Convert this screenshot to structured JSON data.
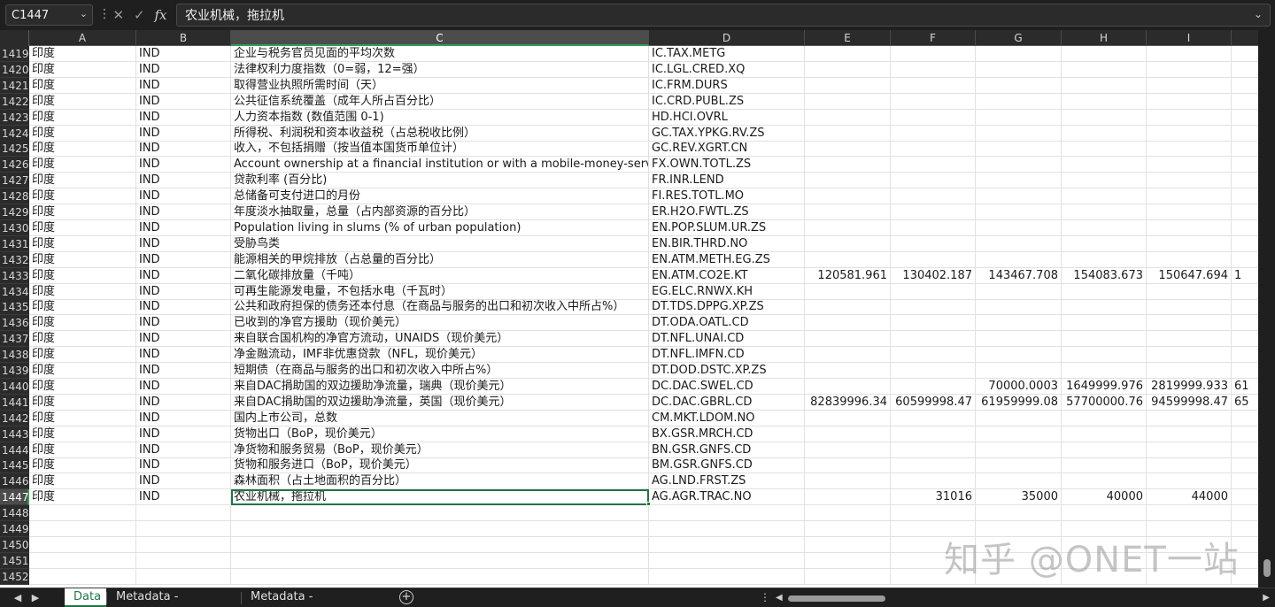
{
  "formula_bar": {
    "name_box": "C1447",
    "cancel_icon": "close-icon",
    "enter_icon": "check-icon",
    "function_label": "fx",
    "content": "农业机械，拖拉机"
  },
  "columns": [
    "A",
    "B",
    "C",
    "D",
    "E",
    "F",
    "G",
    "H",
    "I"
  ],
  "selected_column": "C",
  "rows": [
    {
      "n": "1419",
      "a": "印度",
      "b": "IND",
      "c": "企业与税务官员见面的平均次数",
      "d": "IC.TAX.METG",
      "e": "",
      "f": "",
      "g": "",
      "h": "",
      "i": "",
      "j": ""
    },
    {
      "n": "1420",
      "a": "印度",
      "b": "IND",
      "c": "法律权利力度指数（0=弱，12=强）",
      "d": "IC.LGL.CRED.XQ",
      "e": "",
      "f": "",
      "g": "",
      "h": "",
      "i": "",
      "j": ""
    },
    {
      "n": "1421",
      "a": "印度",
      "b": "IND",
      "c": "取得营业执照所需时间（天）",
      "d": "IC.FRM.DURS",
      "e": "",
      "f": "",
      "g": "",
      "h": "",
      "i": "",
      "j": ""
    },
    {
      "n": "1422",
      "a": "印度",
      "b": "IND",
      "c": "公共征信系统覆盖（成年人所占百分比）",
      "d": "IC.CRD.PUBL.ZS",
      "e": "",
      "f": "",
      "g": "",
      "h": "",
      "i": "",
      "j": ""
    },
    {
      "n": "1423",
      "a": "印度",
      "b": "IND",
      "c": "人力资本指数 (数值范围 0-1)",
      "d": "HD.HCI.OVRL",
      "e": "",
      "f": "",
      "g": "",
      "h": "",
      "i": "",
      "j": ""
    },
    {
      "n": "1424",
      "a": "印度",
      "b": "IND",
      "c": "所得税、利润税和资本收益税（占总税收比例）",
      "d": "GC.TAX.YPKG.RV.ZS",
      "e": "",
      "f": "",
      "g": "",
      "h": "",
      "i": "",
      "j": ""
    },
    {
      "n": "1425",
      "a": "印度",
      "b": "IND",
      "c": "收入，不包括捐赠（按当值本国货币单位计）",
      "d": "GC.REV.XGRT.CN",
      "e": "",
      "f": "",
      "g": "",
      "h": "",
      "i": "",
      "j": ""
    },
    {
      "n": "1426",
      "a": "印度",
      "b": "IND",
      "c": "Account ownership at a financial institution or with a mobile-money-service p",
      "d": "FX.OWN.TOTL.ZS",
      "e": "",
      "f": "",
      "g": "",
      "h": "",
      "i": "",
      "j": ""
    },
    {
      "n": "1427",
      "a": "印度",
      "b": "IND",
      "c": "贷款利率 (百分比)",
      "d": "FR.INR.LEND",
      "e": "",
      "f": "",
      "g": "",
      "h": "",
      "i": "",
      "j": ""
    },
    {
      "n": "1428",
      "a": "印度",
      "b": "IND",
      "c": "总储备可支付进口的月份",
      "d": "FI.RES.TOTL.MO",
      "e": "",
      "f": "",
      "g": "",
      "h": "",
      "i": "",
      "j": ""
    },
    {
      "n": "1429",
      "a": "印度",
      "b": "IND",
      "c": "年度淡水抽取量，总量（占内部资源的百分比）",
      "d": "ER.H2O.FWTL.ZS",
      "e": "",
      "f": "",
      "g": "",
      "h": "",
      "i": "",
      "j": ""
    },
    {
      "n": "1430",
      "a": "印度",
      "b": "IND",
      "c": "Population living in slums (% of urban population)",
      "d": "EN.POP.SLUM.UR.ZS",
      "e": "",
      "f": "",
      "g": "",
      "h": "",
      "i": "",
      "j": ""
    },
    {
      "n": "1431",
      "a": "印度",
      "b": "IND",
      "c": "受胁鸟类",
      "d": "EN.BIR.THRD.NO",
      "e": "",
      "f": "",
      "g": "",
      "h": "",
      "i": "",
      "j": ""
    },
    {
      "n": "1432",
      "a": "印度",
      "b": "IND",
      "c": "能源相关的甲烷排放（占总量的百分比）",
      "d": "EN.ATM.METH.EG.ZS",
      "e": "",
      "f": "",
      "g": "",
      "h": "",
      "i": "",
      "j": ""
    },
    {
      "n": "1433",
      "a": "印度",
      "b": "IND",
      "c": "二氧化碳排放量（千吨）",
      "d": "EN.ATM.CO2E.KT",
      "e": "120581.961",
      "f": "130402.187",
      "g": "143467.708",
      "h": "154083.673",
      "i": "150647.694",
      "j": "1"
    },
    {
      "n": "1434",
      "a": "印度",
      "b": "IND",
      "c": "可再生能源发电量，不包括水电（千瓦时）",
      "d": "EG.ELC.RNWX.KH",
      "e": "",
      "f": "",
      "g": "",
      "h": "",
      "i": "",
      "j": ""
    },
    {
      "n": "1435",
      "a": "印度",
      "b": "IND",
      "c": "公共和政府担保的债务还本付息（在商品与服务的出口和初次收入中所占%）",
      "d": "DT.TDS.DPPG.XP.ZS",
      "e": "",
      "f": "",
      "g": "",
      "h": "",
      "i": "",
      "j": ""
    },
    {
      "n": "1436",
      "a": "印度",
      "b": "IND",
      "c": "已收到的净官方援助（现价美元）",
      "d": "DT.ODA.OATL.CD",
      "e": "",
      "f": "",
      "g": "",
      "h": "",
      "i": "",
      "j": ""
    },
    {
      "n": "1437",
      "a": "印度",
      "b": "IND",
      "c": "来自联合国机构的净官方流动，UNAIDS（现价美元）",
      "d": "DT.NFL.UNAI.CD",
      "e": "",
      "f": "",
      "g": "",
      "h": "",
      "i": "",
      "j": ""
    },
    {
      "n": "1438",
      "a": "印度",
      "b": "IND",
      "c": "净金融流动，IMF非优惠贷款（NFL，现价美元）",
      "d": "DT.NFL.IMFN.CD",
      "e": "",
      "f": "",
      "g": "",
      "h": "",
      "i": "",
      "j": ""
    },
    {
      "n": "1439",
      "a": "印度",
      "b": "IND",
      "c": "短期债（在商品与服务的出口和初次收入中所占%）",
      "d": "DT.DOD.DSTC.XP.ZS",
      "e": "",
      "f": "",
      "g": "",
      "h": "",
      "i": "",
      "j": ""
    },
    {
      "n": "1440",
      "a": "印度",
      "b": "IND",
      "c": "来自DAC捐助国的双边援助净流量，瑞典（现价美元）",
      "d": "DC.DAC.SWEL.CD",
      "e": "",
      "f": "",
      "g": "70000.0003",
      "h": "1649999.976",
      "i": "2819999.933",
      "j": "61"
    },
    {
      "n": "1441",
      "a": "印度",
      "b": "IND",
      "c": "来自DAC捐助国的双边援助净流量，英国（现价美元）",
      "d": "DC.DAC.GBRL.CD",
      "e": "82839996.34",
      "f": "60599998.47",
      "g": "61959999.08",
      "h": "57700000.76",
      "i": "94599998.47",
      "j": "65"
    },
    {
      "n": "1442",
      "a": "印度",
      "b": "IND",
      "c": "国内上市公司，总数",
      "d": "CM.MKT.LDOM.NO",
      "e": "",
      "f": "",
      "g": "",
      "h": "",
      "i": "",
      "j": ""
    },
    {
      "n": "1443",
      "a": "印度",
      "b": "IND",
      "c": "货物出口（BoP，现价美元）",
      "d": "BX.GSR.MRCH.CD",
      "e": "",
      "f": "",
      "g": "",
      "h": "",
      "i": "",
      "j": ""
    },
    {
      "n": "1444",
      "a": "印度",
      "b": "IND",
      "c": "净货物和服务贸易（BoP，现价美元）",
      "d": "BN.GSR.GNFS.CD",
      "e": "",
      "f": "",
      "g": "",
      "h": "",
      "i": "",
      "j": ""
    },
    {
      "n": "1445",
      "a": "印度",
      "b": "IND",
      "c": "货物和服务进口（BoP，现价美元）",
      "d": "BM.GSR.GNFS.CD",
      "e": "",
      "f": "",
      "g": "",
      "h": "",
      "i": "",
      "j": ""
    },
    {
      "n": "1446",
      "a": "印度",
      "b": "IND",
      "c": "森林面积（占土地面积的百分比）",
      "d": "AG.LND.FRST.ZS",
      "e": "",
      "f": "",
      "g": "",
      "h": "",
      "i": "",
      "j": ""
    },
    {
      "n": "1447",
      "a": "印度",
      "b": "IND",
      "c": "农业机械，拖拉机",
      "d": "AG.AGR.TRAC.NO",
      "e": "",
      "f": "31016",
      "g": "35000",
      "h": "40000",
      "i": "44000",
      "j": ""
    },
    {
      "n": "1448",
      "a": "",
      "b": "",
      "c": "",
      "d": "",
      "e": "",
      "f": "",
      "g": "",
      "h": "",
      "i": "",
      "j": ""
    },
    {
      "n": "1449",
      "a": "",
      "b": "",
      "c": "",
      "d": "",
      "e": "",
      "f": "",
      "g": "",
      "h": "",
      "i": "",
      "j": ""
    },
    {
      "n": "1450",
      "a": "",
      "b": "",
      "c": "",
      "d": "",
      "e": "",
      "f": "",
      "g": "",
      "h": "",
      "i": "",
      "j": ""
    },
    {
      "n": "1451",
      "a": "",
      "b": "",
      "c": "",
      "d": "",
      "e": "",
      "f": "",
      "g": "",
      "h": "",
      "i": "",
      "j": ""
    },
    {
      "n": "1452",
      "a": "",
      "b": "",
      "c": "",
      "d": "",
      "e": "",
      "f": "",
      "g": "",
      "h": "",
      "i": "",
      "j": ""
    }
  ],
  "active_row": "1447",
  "sheet_tabs": [
    "Data",
    "Metadata - Countries",
    "Metadata - Indicators"
  ],
  "active_tab": "Data",
  "add_sheet_icon": "plus-circle-icon",
  "watermark": "知乎 @ONET一站"
}
